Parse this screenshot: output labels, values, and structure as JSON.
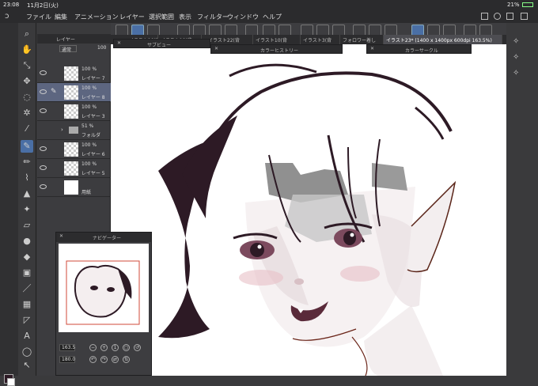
{
  "status": {
    "time": "23:08",
    "date": "11月2日(火)",
    "battery": "21%"
  },
  "menu": [
    "ファイル",
    "編集",
    "アニメーション",
    "レイヤー",
    "選択範囲",
    "表示",
    "フィルター",
    "ウィンドウ",
    "ヘルプ"
  ],
  "tabs": [
    "イラスト10(背",
    "イラスト19(背",
    "イラスト22(背",
    "イラスト10(背",
    "イラスト3(背",
    "フォロワー着し",
    "イラスト23* (1400 x 1400px 600dpi 163.5%)"
  ],
  "layer_panel": {
    "title": "レイヤー",
    "blend": "通常",
    "opacity": "100",
    "layers": [
      {
        "pct": "100 %",
        "name": "レイヤー 7"
      },
      {
        "pct": "100 %",
        "name": "レイヤー 8"
      },
      {
        "pct": "100 %",
        "name": "レイヤー 3"
      },
      {
        "pct": "51 %",
        "name": "フォルダ"
      },
      {
        "pct": "100 %",
        "name": "レイヤー 6"
      },
      {
        "pct": "100 %",
        "name": "レイヤー 5"
      },
      {
        "pct": "",
        "name": "用紙"
      }
    ]
  },
  "floating": {
    "subview": "サブビュー",
    "color_history": "カラーヒストリー",
    "color_circle": "カラーサークル",
    "navigator": "ナビゲーター"
  },
  "navigator": {
    "zoom": "163.5",
    "rotate": "180.0"
  },
  "colors": {
    "accent": "#4a6fa5",
    "hair": "#2d1a25",
    "skin_shade": "#dcc8cc",
    "panel": "#3c3c3f"
  }
}
